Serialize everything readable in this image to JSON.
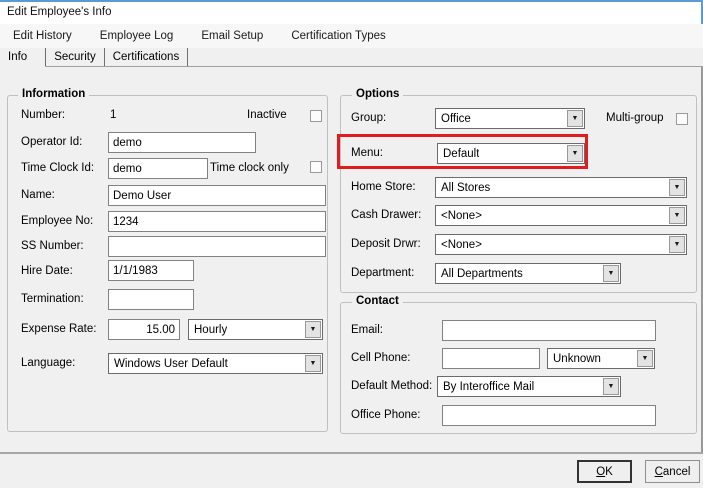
{
  "window": {
    "title": "Edit Employee's Info"
  },
  "menu_bar": {
    "items": [
      "Edit History",
      "Employee Log",
      "Email Setup",
      "Certification Types"
    ]
  },
  "tabs": {
    "info": "Info",
    "security": "Security",
    "certifications": "Certifications",
    "selected": "Info"
  },
  "information": {
    "caption": "Information",
    "number_label": "Number:",
    "number_value": "1",
    "inactive_label": "Inactive",
    "operator_id_label": "Operator Id:",
    "operator_id_value": "demo",
    "time_clock_id_label": "Time Clock Id:",
    "time_clock_id_value": "demo",
    "time_clock_only_label": "Time clock only",
    "name_label": "Name:",
    "name_value": "Demo User",
    "employee_no_label": "Employee No:",
    "employee_no_value": "1234",
    "ss_number_label": "SS Number:",
    "ss_number_value": "",
    "hire_date_label": "Hire Date:",
    "hire_date_value": "1/1/1983",
    "termination_label": "Termination:",
    "termination_value": "",
    "expense_rate_label": "Expense Rate:",
    "expense_rate_value": "15.00",
    "expense_rate_unit": "Hourly",
    "language_label": "Language:",
    "language_value": "Windows User Default"
  },
  "options": {
    "caption": "Options",
    "group_label": "Group:",
    "group_value": "Office",
    "multi_group_label": "Multi-group",
    "menu_label": "Menu:",
    "menu_value": "Default",
    "home_store_label": "Home Store:",
    "home_store_value": "All Stores",
    "cash_drawer_label": "Cash Drawer:",
    "cash_drawer_value": "<None>",
    "deposit_drwr_label": "Deposit Drwr:",
    "deposit_drwr_value": "<None>",
    "department_label": "Department:",
    "department_value": "All Departments"
  },
  "contact": {
    "caption": "Contact",
    "email_label": "Email:",
    "email_value": "",
    "cell_phone_label": "Cell Phone:",
    "cell_phone_value": "",
    "cell_phone_type_value": "Unknown",
    "default_method_label": "Default Method:",
    "default_method_value": "By Interoffice Mail",
    "office_phone_label": "Office Phone:",
    "office_phone_value": ""
  },
  "buttons": {
    "ok": "OK",
    "cancel": "Cancel"
  },
  "colors": {
    "accent_border": "#5b9bd5",
    "highlight_red": "#e11c1c"
  },
  "icons": {
    "dropdown_arrow": "▼"
  }
}
